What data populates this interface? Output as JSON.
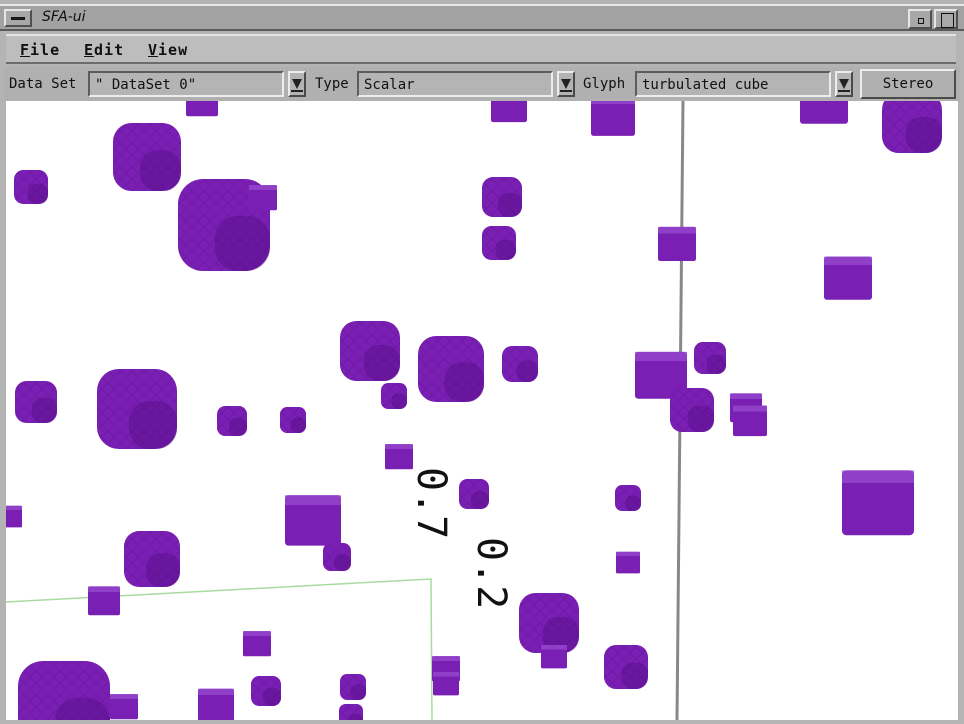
{
  "window": {
    "title": "SFA-ui"
  },
  "menu": {
    "file": "File",
    "edit": "Edit",
    "view": "View"
  },
  "toolbar": {
    "dataset_label": "Data Set",
    "dataset_value": "\" DataSet 0\"",
    "type_label": "Type",
    "type_value": "Scalar",
    "glyph_label": "Glyph",
    "glyph_value": "turbulated cube",
    "stereo_label": "Stereo"
  },
  "scene": {
    "glyph_color": "#7a1fb4",
    "axis_labels": [
      "0.7",
      "0.2"
    ]
  }
}
